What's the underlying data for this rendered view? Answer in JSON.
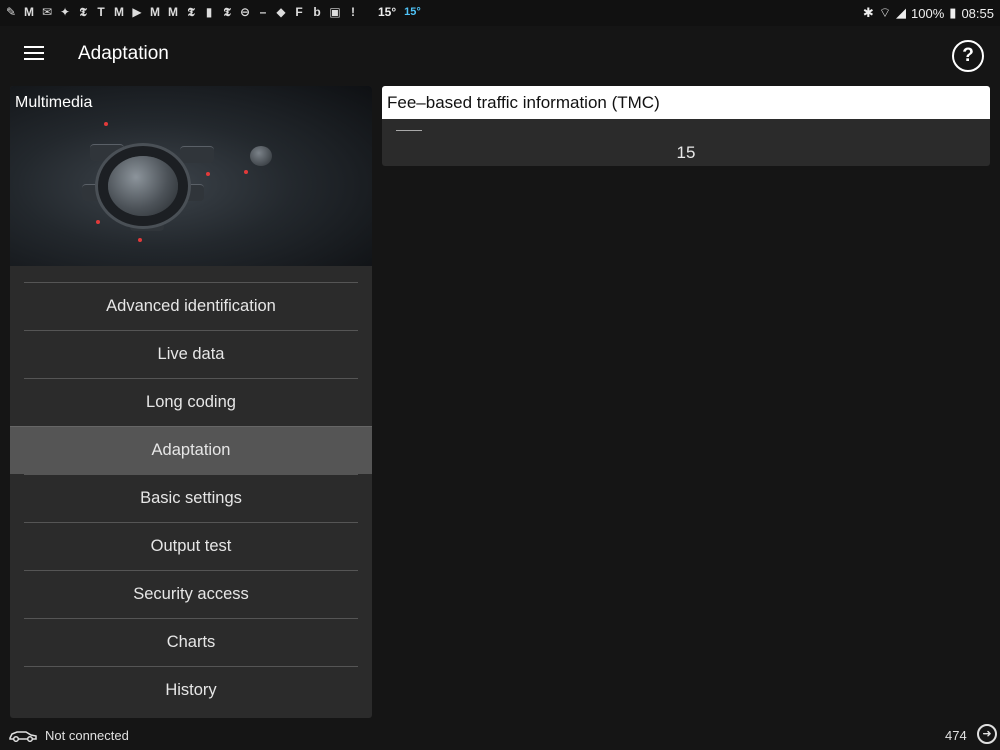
{
  "statusbar": {
    "left_icons": [
      "pen-icon",
      "gmail-icon",
      "mail-icon",
      "twitter-icon",
      "nyt-icon",
      "nyt-t-icon",
      "gmail-icon",
      "play-icon",
      "gmail-icon",
      "gmail-icon",
      "nyt-icon",
      "bars-icon",
      "nyt-icon",
      "minus-circle-icon",
      "dash-icon",
      "diamond-icon",
      "flipboard-icon",
      "b-icon",
      "image-icon",
      "alert-icon"
    ],
    "temp1": "15°",
    "temp2": "15°",
    "battery": "100%",
    "time": "08:55"
  },
  "toolbar": {
    "title": "Adaptation",
    "help": "?"
  },
  "left": {
    "module_title": "Multimedia",
    "menu": [
      {
        "label": "Advanced identification",
        "active": false
      },
      {
        "label": "Live data",
        "active": false
      },
      {
        "label": "Long coding",
        "active": false
      },
      {
        "label": "Adaptation",
        "active": true
      },
      {
        "label": "Basic settings",
        "active": false
      },
      {
        "label": "Output test",
        "active": false
      },
      {
        "label": "Security access",
        "active": false
      },
      {
        "label": "Charts",
        "active": false
      },
      {
        "label": "History",
        "active": false
      }
    ]
  },
  "param": {
    "title": "Fee–based traffic information (TMC)",
    "dash": "——",
    "value": "15"
  },
  "footer": {
    "status": "Not connected",
    "count": "474"
  }
}
